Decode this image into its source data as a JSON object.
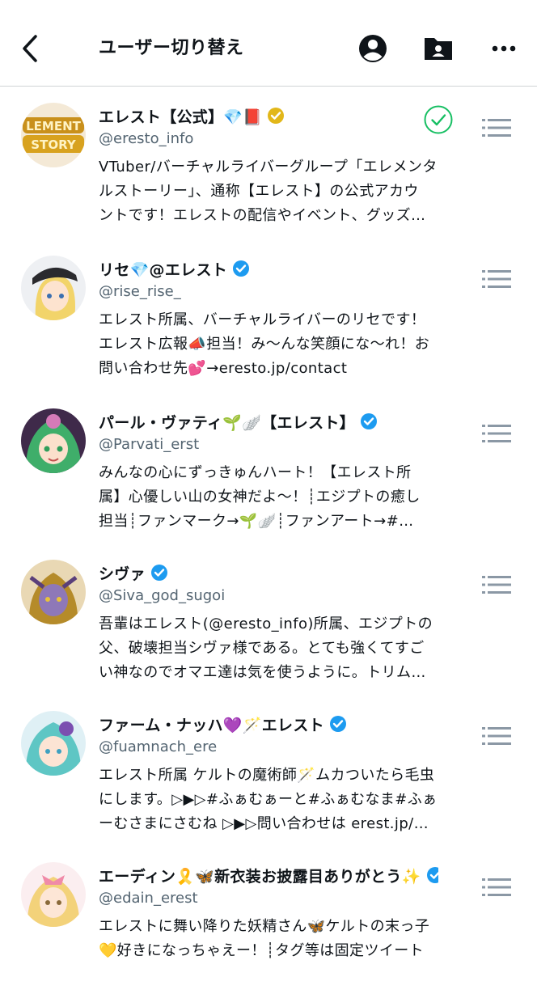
{
  "header": {
    "title": "ユーザー切り替え",
    "icons": [
      "back-icon",
      "account-icon",
      "folder-user-icon",
      "more-icon"
    ]
  },
  "colors": {
    "verified_blue": "#1d9bf0",
    "verified_gold": "#e2b719",
    "handle_gray": "#536471",
    "selected_green": "#17bf63",
    "menu_gray": "#8b98a5"
  },
  "users": [
    {
      "name": "エレスト【公式】💎📕",
      "handle": "@eresto_info",
      "badge": "gold",
      "selected": true,
      "bio": [
        "VTuber/バーチャルライバーグループ「エレメンタ",
        "ルストーリー」、通称【エレスト】の公式アカウ",
        "ントです！エレストの配信やイベント、グッズ…"
      ]
    },
    {
      "name": "リセ💎@エレスト",
      "handle": "@rise_rise_",
      "badge": "blue",
      "selected": false,
      "bio": [
        "エレスト所属、バーチャルライバーのリセです！",
        "エレスト広報📣担当！み〜んな笑顔にな〜れ！お",
        "問い合わせ先💕→eresto.jp/contact"
      ]
    },
    {
      "name": "パール・ヴァティ🌱🪽【エレスト】",
      "handle": "@Parvati_erst",
      "badge": "blue",
      "selected": false,
      "bio": [
        "みんなの心にずっきゅんハート！【エレスト所",
        "属】心優しい山の女神だよ〜！┊エジプトの癒し",
        "担当┊ファンマーク→🌱🪽┊ファンアート→#…"
      ]
    },
    {
      "name": "シヴァ",
      "handle": "@Siva_god_sugoi",
      "badge": "blue",
      "selected": false,
      "bio": [
        "吾輩はエレスト(@eresto_info)所属、エジプトの",
        "父、破壊担当シヴァ様である。とても強くてすご",
        "い神なのでオマエ達は気を使うように。トリム…"
      ]
    },
    {
      "name": "ファーム・ナッハ💜🪄エレスト",
      "handle": "@fuamnach_ere",
      "badge": "blue",
      "selected": false,
      "bio": [
        "エレスト所属 ケルトの魔術師🪄ムカついたら毛虫",
        "にします。▷▶▷#ふぁむぁーと#ふぁむなま#ふぁ",
        "ーむさまにさむね ▷▶▷問い合わせは erest.jp/…"
      ]
    },
    {
      "name": "エーディン🎗️🦋新衣装お披露目ありがとう✨",
      "handle": "@edain_erest",
      "badge": "blue",
      "selected": false,
      "bio": [
        "エレストに舞い降りた妖精さん🦋ケルトの末っ子",
        "💛好きになっちゃえー！┊タグ等は固定ツイート"
      ]
    }
  ]
}
